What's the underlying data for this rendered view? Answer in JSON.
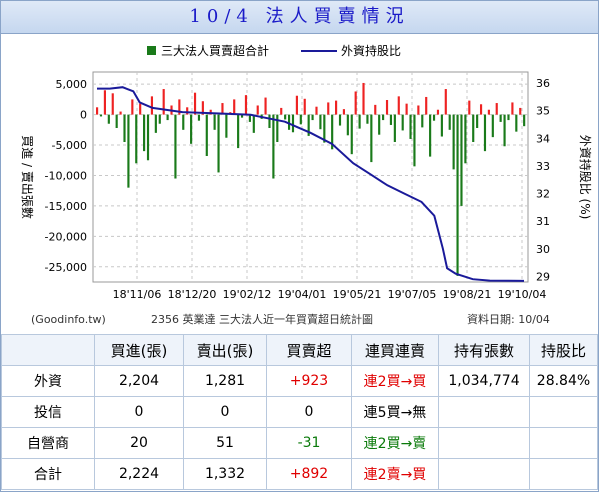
{
  "title": "10/4 法人買賣情況",
  "chart_data": {
    "type": "bar",
    "legend": [
      {
        "name": "三大法人買賣超合計",
        "color": "#1a7a1a",
        "marker": "square"
      },
      {
        "name": "外資持股比",
        "color": "#1a1a9a",
        "marker": "line"
      }
    ],
    "legend_placement": "top",
    "left_axis": {
      "label": "買進 / 賣出張數",
      "ticks": [
        5000,
        0,
        -5000,
        -10000,
        -15000,
        -20000,
        -25000
      ],
      "tick_labels": [
        "5,000",
        "0",
        "-5,000",
        "-10,000",
        "-15,000",
        "-20,000",
        "-25,000"
      ],
      "range": [
        -27500,
        7000
      ]
    },
    "right_axis": {
      "label": "外資持股比 (%)",
      "ticks": [
        36,
        35,
        34,
        33,
        32,
        31,
        30,
        29
      ],
      "tick_labels": [
        "36",
        "35",
        "34",
        "33",
        "32",
        "31",
        "30",
        "29"
      ],
      "range": [
        28.8,
        36.4
      ]
    },
    "x_tick_labels": [
      "18'11/06",
      "18'12/20",
      "19'02/12",
      "19'04/01",
      "19'05/21",
      "19'07/05",
      "19'08/21",
      "19'10/04"
    ],
    "grid": true,
    "colors": {
      "positive": "#ee2222",
      "negative": "#1a7a1a",
      "line": "#1a1a9a"
    },
    "foreign_holding_ratio_points": [
      {
        "x": 0.0,
        "y": 35.8
      },
      {
        "x": 0.03,
        "y": 35.8
      },
      {
        "x": 0.06,
        "y": 35.85
      },
      {
        "x": 0.085,
        "y": 35.7
      },
      {
        "x": 0.1,
        "y": 35.3
      },
      {
        "x": 0.13,
        "y": 35.1
      },
      {
        "x": 0.2,
        "y": 34.95
      },
      {
        "x": 0.28,
        "y": 34.9
      },
      {
        "x": 0.36,
        "y": 34.85
      },
      {
        "x": 0.44,
        "y": 34.6
      },
      {
        "x": 0.47,
        "y": 34.4
      },
      {
        "x": 0.5,
        "y": 34.2
      },
      {
        "x": 0.55,
        "y": 33.8
      },
      {
        "x": 0.6,
        "y": 33.1
      },
      {
        "x": 0.64,
        "y": 32.7
      },
      {
        "x": 0.68,
        "y": 32.3
      },
      {
        "x": 0.72,
        "y": 32.0
      },
      {
        "x": 0.76,
        "y": 31.7
      },
      {
        "x": 0.79,
        "y": 31.2
      },
      {
        "x": 0.8,
        "y": 30.6
      },
      {
        "x": 0.81,
        "y": 30.0
      },
      {
        "x": 0.82,
        "y": 29.3
      },
      {
        "x": 0.84,
        "y": 29.1
      },
      {
        "x": 0.88,
        "y": 28.9
      },
      {
        "x": 0.92,
        "y": 28.85
      },
      {
        "x": 1.0,
        "y": 28.84
      }
    ],
    "net_buy_sell_values": [
      1200,
      -300,
      4000,
      -1500,
      3500,
      -2200,
      500,
      -4500,
      -12000,
      2500,
      -8000,
      1800,
      -6000,
      -7500,
      3000,
      -3000,
      -1500,
      4200,
      -900,
      1500,
      -10500,
      2500,
      -2500,
      1200,
      -4800,
      3600,
      -1000,
      2200,
      -6800,
      800,
      -2500,
      -9500,
      1900,
      -3800,
      400,
      2500,
      -5500,
      -500,
      3200,
      -1200,
      -3000,
      1500,
      -700,
      2800,
      -2200,
      -10500,
      -4500,
      1100,
      -800,
      -2500,
      -2900,
      3100,
      -1600,
      2600,
      -3500,
      -900,
      1300,
      -2400,
      -4600,
      2000,
      -5700,
      2300,
      -1800,
      900,
      -3400,
      -6500,
      3800,
      -2300,
      5200,
      -1500,
      -7800,
      1600,
      -3300,
      -900,
      2400,
      -1700,
      -4500,
      3000,
      -2600,
      1800,
      -4000,
      -8500,
      1500,
      -2100,
      2900,
      -6900,
      -1000,
      800,
      -3600,
      4200,
      -2500,
      -9000,
      -26500,
      -15000,
      -8000,
      2300,
      -4500,
      -2200,
      1700,
      -6000,
      800,
      -3700,
      1900,
      -1200,
      -5200,
      -900,
      2000,
      -2800,
      1100,
      -1900
    ]
  },
  "footer": {
    "source": "(Goodinfo.tw)",
    "caption": "2356 英業達 三大法人近一年買賣超日統計圖",
    "date": "資料日期: 10/04"
  },
  "table": {
    "headers": [
      "",
      "買進(張)",
      "賣出(張)",
      "買賣超",
      "連買連賣",
      "持有張數",
      "持股比"
    ],
    "rows": [
      {
        "label": "外資",
        "buy": "2,204",
        "sell": "1,281",
        "net": "+923",
        "net_class": "red",
        "streak": "連2買→買",
        "streak_class": "red",
        "holding": "1,034,774",
        "ratio": "28.84%"
      },
      {
        "label": "投信",
        "buy": "0",
        "sell": "0",
        "net": "0",
        "net_class": "",
        "streak": "連5買→無",
        "streak_class": "",
        "holding": "",
        "ratio": ""
      },
      {
        "label": "自營商",
        "buy": "20",
        "sell": "51",
        "net": "-31",
        "net_class": "green",
        "streak": "連2買→賣",
        "streak_class": "green",
        "holding": "",
        "ratio": ""
      },
      {
        "label": "合計",
        "buy": "2,224",
        "sell": "1,332",
        "net": "+892",
        "net_class": "red",
        "streak": "連2賣→買",
        "streak_class": "red",
        "holding": "",
        "ratio": ""
      }
    ]
  }
}
